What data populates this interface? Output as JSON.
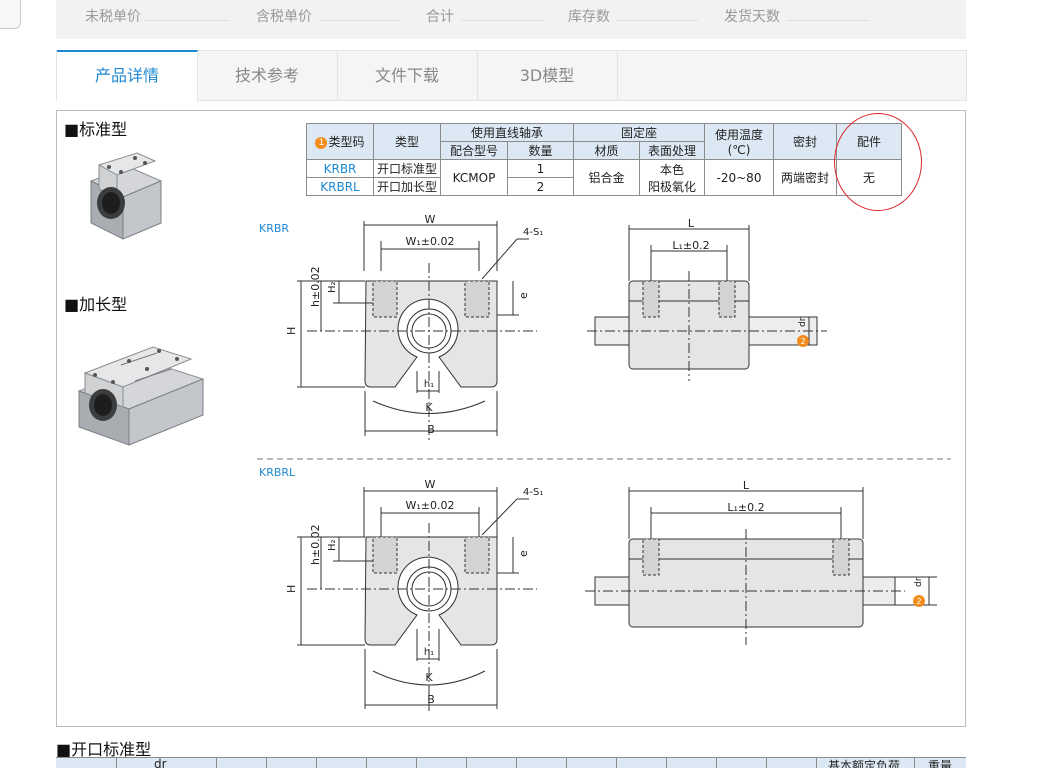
{
  "price_bar": {
    "fields": [
      "未税单价",
      "含税单价",
      "合计",
      "库存数",
      "发货天数"
    ]
  },
  "tabs": [
    {
      "label": "产品详情",
      "active": true
    },
    {
      "label": "技术参考",
      "active": false
    },
    {
      "label": "文件下载",
      "active": false
    },
    {
      "label": "3D模型",
      "active": false
    }
  ],
  "sections": {
    "standard": "■标准型",
    "extended": "■加长型"
  },
  "spec_table": {
    "h_type_code": "类型码",
    "h_type_code_num": "1",
    "h_type": "类型",
    "h_bearing": "使用直线轴承",
    "h_model": "配合型号",
    "h_qty": "数量",
    "h_fixed": "固定座",
    "h_material": "材质",
    "h_surface": "表面处理",
    "h_temp": "使用温度",
    "h_temp_unit": "(℃)",
    "h_seal": "密封",
    "h_accessory": "配件",
    "rows": [
      {
        "code": "KRBR",
        "type": "开口标准型",
        "qty": "1"
      },
      {
        "code": "KRBRL",
        "type": "开口加长型",
        "qty": "2"
      }
    ],
    "model": "KCMOP",
    "material": "铝合金",
    "surface_1": "本色",
    "surface_2": "阳极氧化",
    "temp": "-20~80",
    "seal": "两端密封",
    "accessory": "无"
  },
  "diagrams": {
    "krbr_label": "KRBR",
    "krbrl_label": "KRBRL",
    "W": "W",
    "W1": "W₁±0.02",
    "S1": "4-S₁",
    "H": "H",
    "h": "h±0.02",
    "H2": "H₂",
    "e": "e",
    "h1": "h₁",
    "K": "K",
    "B": "B",
    "L": "L",
    "L1": "L₁±0.2",
    "dr": "dr",
    "badge2": "2"
  },
  "bottom": {
    "title": "■开口标准型",
    "header_frag_1": "dr",
    "header_frag_2": "基本额定负荷",
    "header_frag_3": "重量"
  },
  "colors": {
    "accent": "#1e88d3",
    "header_bg": "#dce9f5",
    "badge": "#f28c1b",
    "highlight": "#d9252b"
  }
}
